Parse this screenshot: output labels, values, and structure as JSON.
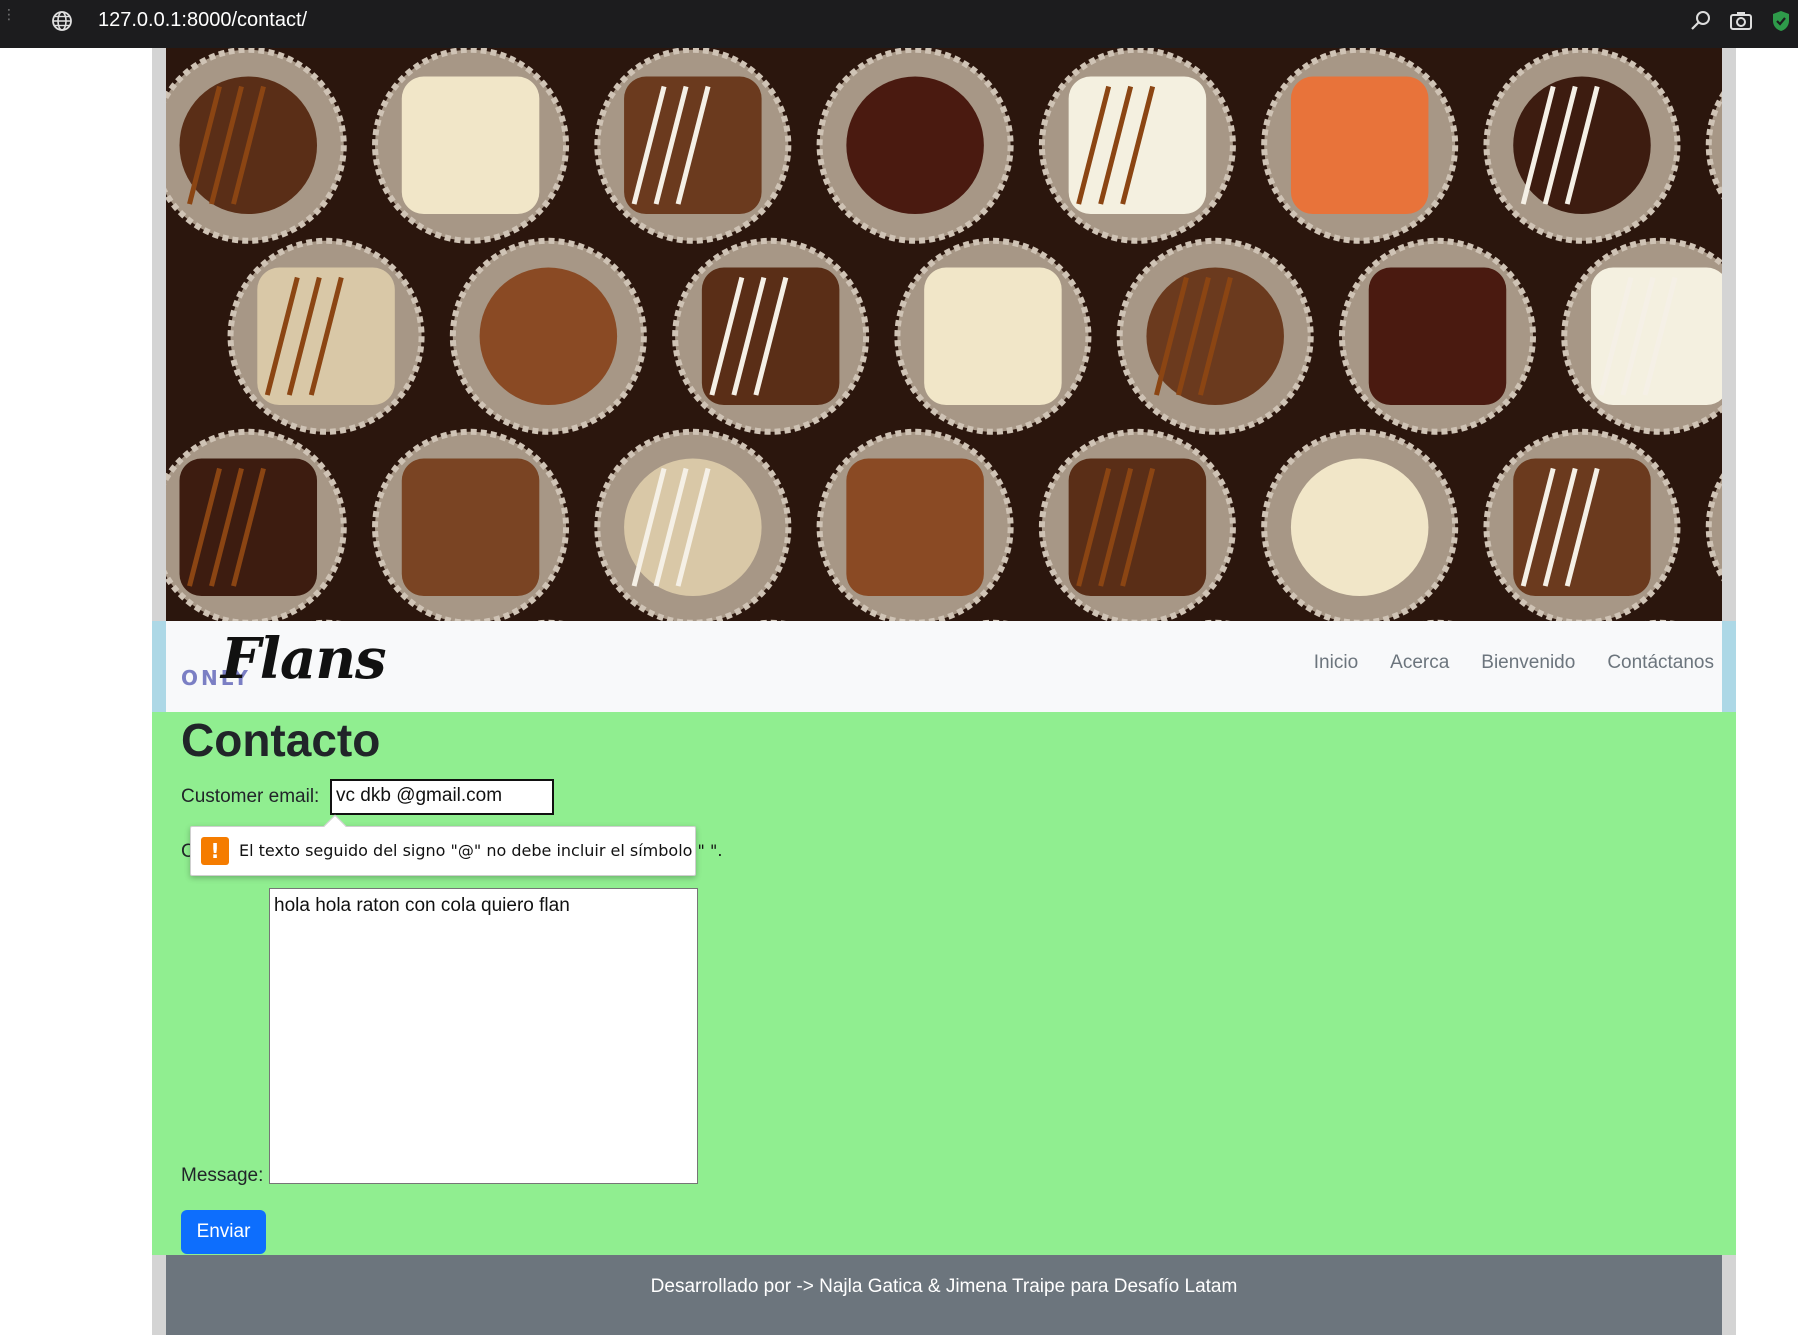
{
  "browser": {
    "url": "127.0.0.1:8000/contact/",
    "icons": [
      "globe-icon",
      "zoom-icon",
      "camera-icon",
      "shield-check-icon"
    ]
  },
  "brand": {
    "prefix": "ONLY",
    "name": "Flans"
  },
  "nav": {
    "items": [
      "Inicio",
      "Acerca",
      "Bienvenido",
      "Contáctanos"
    ]
  },
  "page": {
    "title": "Contacto"
  },
  "form": {
    "email_label": "Customer email:",
    "email_value": "vc dkb @gmail.com",
    "hidden_label": "C",
    "message_label": "Message:",
    "message_value": "hola hola raton con cola quiero flan",
    "submit_label": "Enviar"
  },
  "validation": {
    "message": "El texto seguido del signo \"@\" no debe incluir el símbolo \" \"."
  },
  "footer": {
    "text": "Desarrollado por -> Najla Gatica & Jimena Traipe para Desafío Latam"
  },
  "colors": {
    "main_background": "#90ee90",
    "navbar_background": "#f8f9fa",
    "footer_background": "#6c757d",
    "button": "#0d6efd",
    "warning": "#f57c00"
  }
}
